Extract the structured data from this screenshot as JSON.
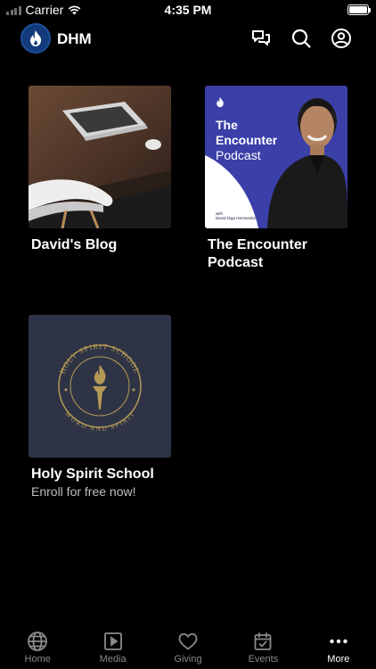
{
  "status_bar": {
    "carrier": "Carrier",
    "time": "4:35 PM"
  },
  "header": {
    "app_name": "DHM",
    "icons": [
      "chat-icon",
      "search-icon",
      "account-icon"
    ]
  },
  "cards": [
    {
      "title": "David's Blog",
      "subtitle": "",
      "image": "laptop-desk-photo"
    },
    {
      "title": "The Encounter Podcast",
      "subtitle": "",
      "image": "podcast-artwork",
      "artwork_text": {
        "line1": "The",
        "line2": "Encounter",
        "line3": "Podcast",
        "host": "with\nDavid Diga Hernandez"
      }
    },
    {
      "title": "Holy Spirit School",
      "subtitle": "Enroll for free now!",
      "image": "seal-artwork",
      "seal_text": {
        "top": "HOLY SPIRIT SCHOOL",
        "bottom": "WORD AND SPIRIT"
      }
    }
  ],
  "tabs": [
    {
      "label": "Home",
      "icon": "globe-icon",
      "active": false
    },
    {
      "label": "Media",
      "icon": "play-icon",
      "active": false
    },
    {
      "label": "Giving",
      "icon": "heart-icon",
      "active": false
    },
    {
      "label": "Events",
      "icon": "calendar-icon",
      "active": false
    },
    {
      "label": "More",
      "icon": "more-icon",
      "active": true
    }
  ],
  "colors": {
    "background": "#000000",
    "podcast_accent": "#3b3fa8",
    "seal_gold": "#b59a57",
    "seal_bg": "#2e3445",
    "inactive_tab": "#8a8a8a"
  }
}
